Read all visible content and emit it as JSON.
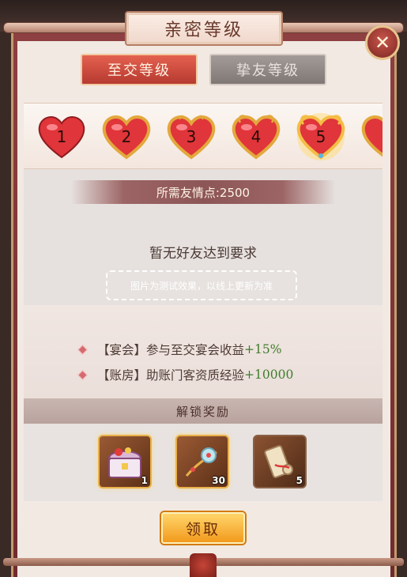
{
  "title": "亲密等级",
  "tabs": [
    {
      "label": "至交等级",
      "active": true
    },
    {
      "label": "挚友等级",
      "active": false
    }
  ],
  "hearts": [
    "1",
    "2",
    "3",
    "4",
    "5"
  ],
  "selected_level": "5",
  "requirement": "所需友情点:2500",
  "empty_message": "暂无好友达到要求",
  "test_note": "图片为测试效果，以线上更新为准",
  "bonuses": [
    {
      "tag": "【宴会】",
      "text": "参与至交宴会收益",
      "value": "+15%"
    },
    {
      "tag": "【账房】",
      "text": "助账门客资质经验",
      "value": "+10000"
    }
  ],
  "rewards_header": "解锁奖励",
  "rewards": [
    {
      "icon": "treasure-chest-icon",
      "qty": "1"
    },
    {
      "icon": "jade-pendant-icon",
      "qty": "30"
    },
    {
      "icon": "scroll-icon",
      "qty": "5"
    }
  ],
  "claim_label": "领取",
  "colors": {
    "accent_red": "#b63a31",
    "gain_green": "#3f7d2c",
    "gold": "#f29a1d"
  }
}
